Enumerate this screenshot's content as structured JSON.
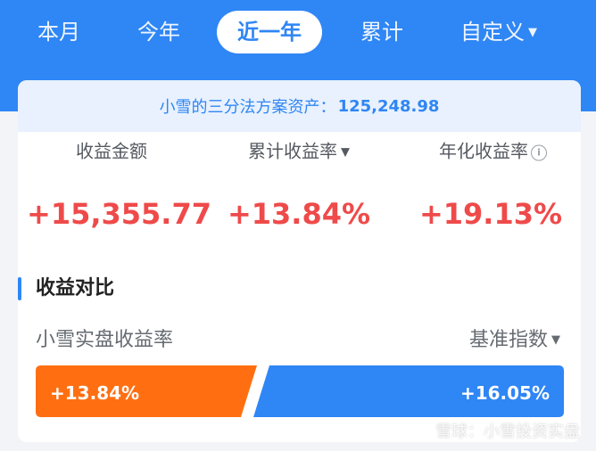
{
  "tabs": [
    {
      "label": "本月"
    },
    {
      "label": "今年"
    },
    {
      "label": "近一年",
      "active": true
    },
    {
      "label": "累计"
    },
    {
      "label": "自定义"
    }
  ],
  "asset": {
    "label": "小雪的三分法方案资产：",
    "value": "125,248.98"
  },
  "metrics": [
    {
      "label": "收益金额",
      "value": "+15,355.77"
    },
    {
      "label": "累计收益率",
      "value": "+13.84%"
    },
    {
      "label": "年化收益率",
      "value": "+19.13%"
    }
  ],
  "section": {
    "title": "收益对比",
    "left_label": "小雪实盘收益率",
    "right_label": "基准指数"
  },
  "comparison": {
    "portfolio_value": "+13.84%",
    "benchmark_value": "+16.05%",
    "portfolio_color": "#ff6f12",
    "benchmark_color": "#2f86f5"
  },
  "watermark": "雪球：小雪投资实盘",
  "colors": {
    "accent": "#2f86f5",
    "positive": "#ef4a4a"
  },
  "icons": {
    "dropdown": "caret-down-icon",
    "info": "info-icon"
  }
}
